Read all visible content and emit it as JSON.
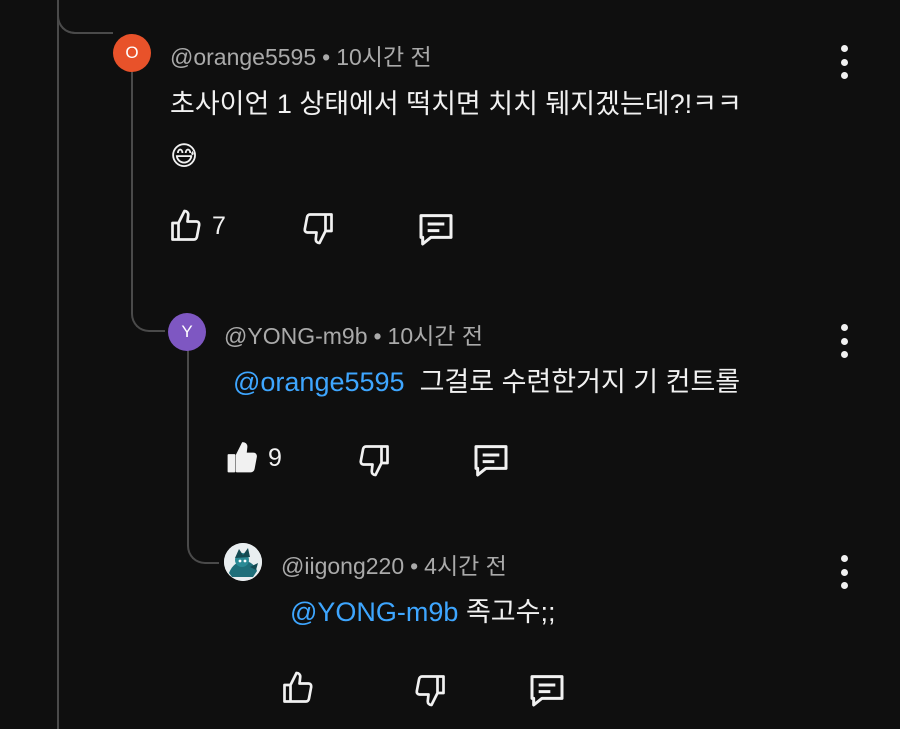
{
  "comments": [
    {
      "author": "@orange5595",
      "time": "10시간 전",
      "avatar_letter": "O",
      "avatar_color": "#e8522a",
      "text_line1": "초사이언 1 상태에서 떡치면 치치 뒈지겠는데?!ㅋㅋ",
      "emoji": "😅",
      "likes": "7",
      "liked": false
    },
    {
      "author": "@YONG-m9b",
      "time": "10시간 전",
      "avatar_letter": "Y",
      "avatar_color": "#7e57c2",
      "mention": "@orange5595",
      "text": "그걸로 수련한거지 기 컨트롤",
      "likes": "9",
      "liked": true
    },
    {
      "author": "@iigong220",
      "time": "4시간 전",
      "avatar_icon": "anime-character-avatar",
      "mention": "@YONG-m9b",
      "text": "족고수;;",
      "likes": "",
      "liked": false
    }
  ],
  "icons": {
    "like": "thumbs-up-icon",
    "dislike": "thumbs-down-icon",
    "reply": "reply-icon",
    "menu": "more-vert-icon"
  },
  "colors": {
    "background": "#0f0f0f",
    "text": "#f1f1f1",
    "meta": "#aaaaaa",
    "mention": "#3ea6ff"
  }
}
